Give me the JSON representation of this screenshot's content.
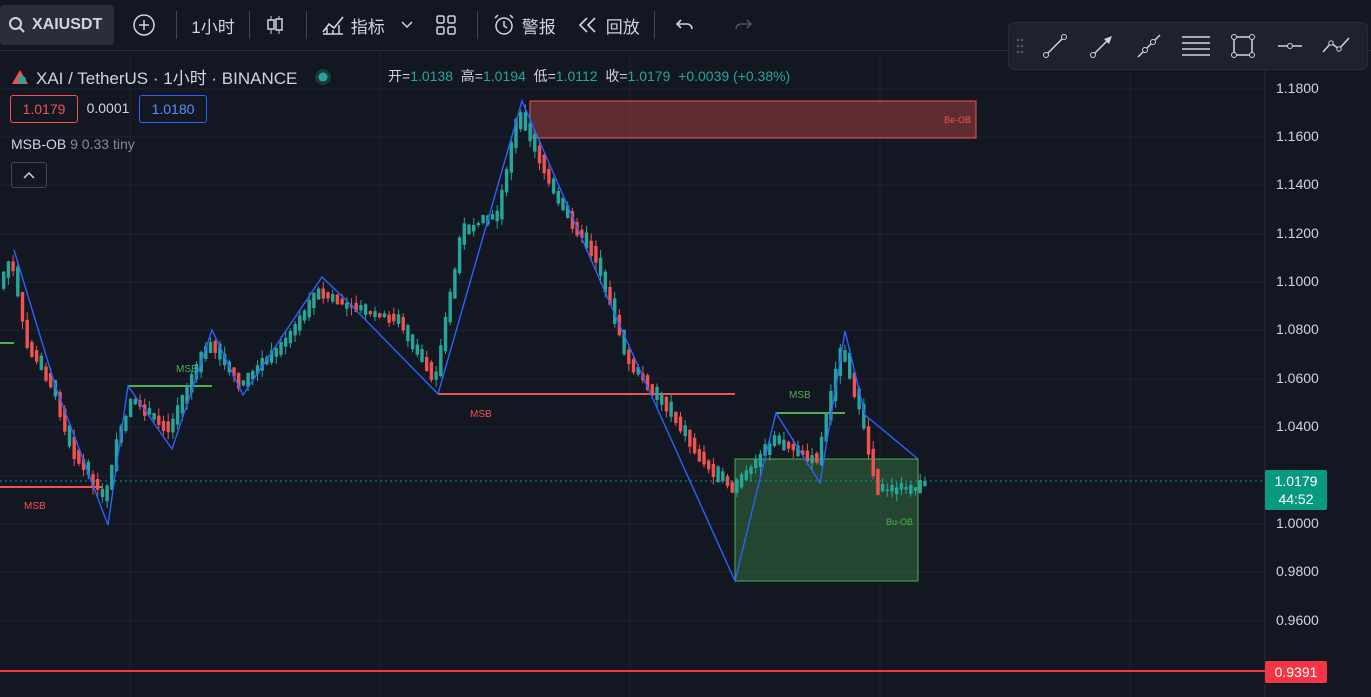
{
  "toolbar": {
    "symbol": "XAIUSDT",
    "interval": "1小时",
    "indicators": "指标",
    "alerts": "警报",
    "replay": "回放"
  },
  "legend": {
    "title": "XAI / TetherUS · 1小时 · BINANCE",
    "open_label": "开=",
    "open": "1.0138",
    "high_label": "高=",
    "high": "1.0194",
    "low_label": "低=",
    "low": "1.0112",
    "close_label": "收=",
    "close": "1.0179",
    "change": "+0.0039 (+0.38%)",
    "bid": "1.0179",
    "spread": "0.0001",
    "ask": "1.0180"
  },
  "indicator": {
    "name": "MSB-OB",
    "params": "9 0.33 tiny"
  },
  "price_axis": {
    "ticks": [
      "1.1800",
      "1.1600",
      "1.1400",
      "1.1200",
      "1.1000",
      "1.0800",
      "1.0600",
      "1.0400",
      "1.0000",
      "0.9800",
      "0.9600"
    ],
    "last_price": "1.0179",
    "countdown": "44:52",
    "alert_price": "0.9391"
  },
  "annotations": {
    "bear_ob": "Be-OB",
    "bull_ob": "Bu-OB",
    "msb": "MSB"
  },
  "colors": {
    "up": "#26a69a",
    "down": "#ef5350",
    "zigzag": "#2962ff",
    "bg": "#131722"
  }
}
